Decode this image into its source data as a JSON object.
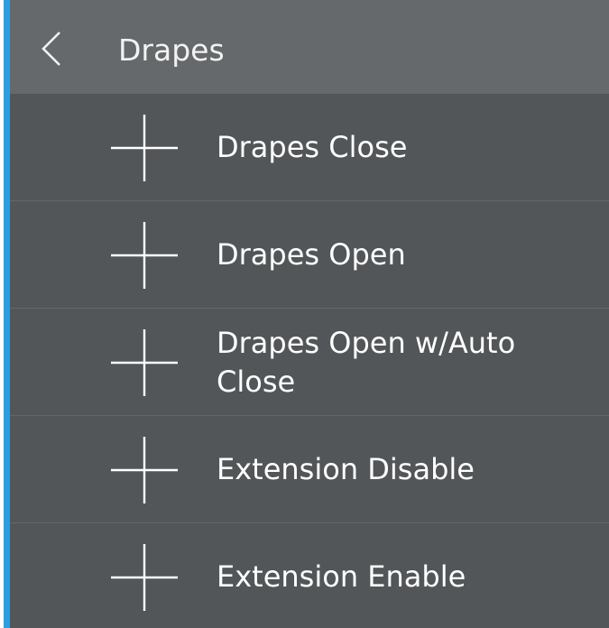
{
  "colors": {
    "accent": "#2b9fe0",
    "header_background": "#65696c",
    "panel_background": "#525658",
    "text": "#ffffff"
  },
  "header": {
    "back_icon": "chevron-left-icon",
    "title": "Drapes"
  },
  "menu": {
    "item_icon": "plus-icon",
    "items": [
      {
        "label": "Drapes Close"
      },
      {
        "label": "Drapes Open"
      },
      {
        "label": "Drapes Open w/Auto Close"
      },
      {
        "label": "Extension Disable"
      },
      {
        "label": "Extension Enable"
      }
    ]
  }
}
